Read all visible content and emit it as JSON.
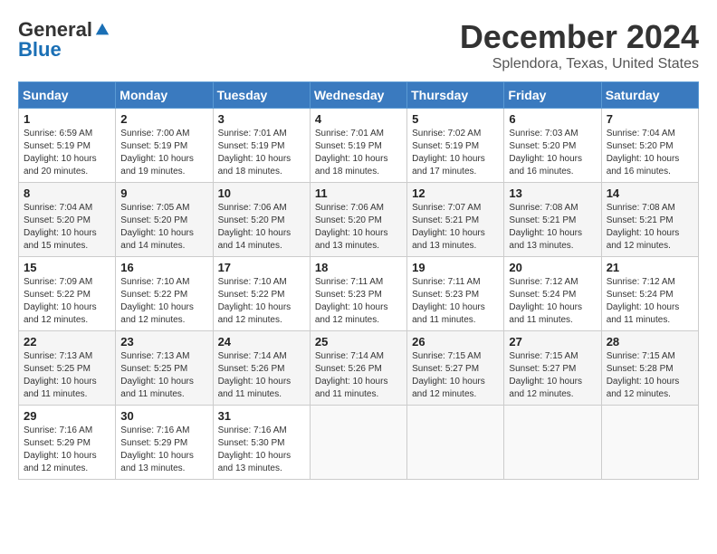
{
  "logo": {
    "general": "General",
    "blue": "Blue"
  },
  "header": {
    "month": "December 2024",
    "location": "Splendora, Texas, United States"
  },
  "weekdays": [
    "Sunday",
    "Monday",
    "Tuesday",
    "Wednesday",
    "Thursday",
    "Friday",
    "Saturday"
  ],
  "weeks": [
    [
      {
        "day": "1",
        "sunrise": "6:59 AM",
        "sunset": "5:19 PM",
        "daylight": "10 hours and 20 minutes."
      },
      {
        "day": "2",
        "sunrise": "7:00 AM",
        "sunset": "5:19 PM",
        "daylight": "10 hours and 19 minutes."
      },
      {
        "day": "3",
        "sunrise": "7:01 AM",
        "sunset": "5:19 PM",
        "daylight": "10 hours and 18 minutes."
      },
      {
        "day": "4",
        "sunrise": "7:01 AM",
        "sunset": "5:19 PM",
        "daylight": "10 hours and 18 minutes."
      },
      {
        "day": "5",
        "sunrise": "7:02 AM",
        "sunset": "5:19 PM",
        "daylight": "10 hours and 17 minutes."
      },
      {
        "day": "6",
        "sunrise": "7:03 AM",
        "sunset": "5:20 PM",
        "daylight": "10 hours and 16 minutes."
      },
      {
        "day": "7",
        "sunrise": "7:04 AM",
        "sunset": "5:20 PM",
        "daylight": "10 hours and 16 minutes."
      }
    ],
    [
      {
        "day": "8",
        "sunrise": "7:04 AM",
        "sunset": "5:20 PM",
        "daylight": "10 hours and 15 minutes."
      },
      {
        "day": "9",
        "sunrise": "7:05 AM",
        "sunset": "5:20 PM",
        "daylight": "10 hours and 14 minutes."
      },
      {
        "day": "10",
        "sunrise": "7:06 AM",
        "sunset": "5:20 PM",
        "daylight": "10 hours and 14 minutes."
      },
      {
        "day": "11",
        "sunrise": "7:06 AM",
        "sunset": "5:20 PM",
        "daylight": "10 hours and 13 minutes."
      },
      {
        "day": "12",
        "sunrise": "7:07 AM",
        "sunset": "5:21 PM",
        "daylight": "10 hours and 13 minutes."
      },
      {
        "day": "13",
        "sunrise": "7:08 AM",
        "sunset": "5:21 PM",
        "daylight": "10 hours and 13 minutes."
      },
      {
        "day": "14",
        "sunrise": "7:08 AM",
        "sunset": "5:21 PM",
        "daylight": "10 hours and 12 minutes."
      }
    ],
    [
      {
        "day": "15",
        "sunrise": "7:09 AM",
        "sunset": "5:22 PM",
        "daylight": "10 hours and 12 minutes."
      },
      {
        "day": "16",
        "sunrise": "7:10 AM",
        "sunset": "5:22 PM",
        "daylight": "10 hours and 12 minutes."
      },
      {
        "day": "17",
        "sunrise": "7:10 AM",
        "sunset": "5:22 PM",
        "daylight": "10 hours and 12 minutes."
      },
      {
        "day": "18",
        "sunrise": "7:11 AM",
        "sunset": "5:23 PM",
        "daylight": "10 hours and 12 minutes."
      },
      {
        "day": "19",
        "sunrise": "7:11 AM",
        "sunset": "5:23 PM",
        "daylight": "10 hours and 11 minutes."
      },
      {
        "day": "20",
        "sunrise": "7:12 AM",
        "sunset": "5:24 PM",
        "daylight": "10 hours and 11 minutes."
      },
      {
        "day": "21",
        "sunrise": "7:12 AM",
        "sunset": "5:24 PM",
        "daylight": "10 hours and 11 minutes."
      }
    ],
    [
      {
        "day": "22",
        "sunrise": "7:13 AM",
        "sunset": "5:25 PM",
        "daylight": "10 hours and 11 minutes."
      },
      {
        "day": "23",
        "sunrise": "7:13 AM",
        "sunset": "5:25 PM",
        "daylight": "10 hours and 11 minutes."
      },
      {
        "day": "24",
        "sunrise": "7:14 AM",
        "sunset": "5:26 PM",
        "daylight": "10 hours and 11 minutes."
      },
      {
        "day": "25",
        "sunrise": "7:14 AM",
        "sunset": "5:26 PM",
        "daylight": "10 hours and 11 minutes."
      },
      {
        "day": "26",
        "sunrise": "7:15 AM",
        "sunset": "5:27 PM",
        "daylight": "10 hours and 12 minutes."
      },
      {
        "day": "27",
        "sunrise": "7:15 AM",
        "sunset": "5:27 PM",
        "daylight": "10 hours and 12 minutes."
      },
      {
        "day": "28",
        "sunrise": "7:15 AM",
        "sunset": "5:28 PM",
        "daylight": "10 hours and 12 minutes."
      }
    ],
    [
      {
        "day": "29",
        "sunrise": "7:16 AM",
        "sunset": "5:29 PM",
        "daylight": "10 hours and 12 minutes."
      },
      {
        "day": "30",
        "sunrise": "7:16 AM",
        "sunset": "5:29 PM",
        "daylight": "10 hours and 13 minutes."
      },
      {
        "day": "31",
        "sunrise": "7:16 AM",
        "sunset": "5:30 PM",
        "daylight": "10 hours and 13 minutes."
      },
      null,
      null,
      null,
      null
    ]
  ],
  "labels": {
    "sunrise": "Sunrise:",
    "sunset": "Sunset:",
    "daylight": "Daylight:"
  }
}
